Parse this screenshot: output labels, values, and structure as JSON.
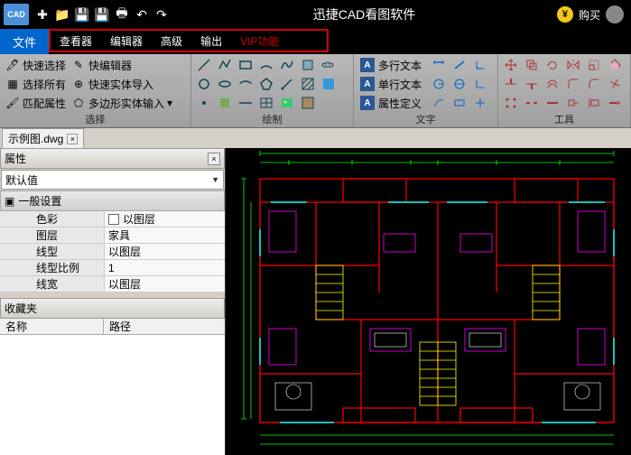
{
  "title": "迅捷CAD看图软件",
  "buy": "购买",
  "menu": {
    "file": "文件",
    "viewer": "查看器",
    "editor": "编辑器",
    "advanced": "高级",
    "output": "输出",
    "vip": "VIP功能"
  },
  "ribbon": {
    "select": {
      "label": "选择",
      "quick": "快速选择",
      "all": "选择所有",
      "match": "匹配属性",
      "qedit": "快编辑器",
      "impent": "快速实体导入",
      "polyin": "多边形实体输入"
    },
    "draw": {
      "label": "绘制"
    },
    "text": {
      "label": "文字",
      "mtext": "多行文本",
      "stext": "单行文本",
      "attdef": "属性定义"
    },
    "tools": {
      "label": "工具"
    }
  },
  "doc": {
    "name": "示例图.dwg"
  },
  "props": {
    "title": "属性",
    "default": "默认值",
    "general": "一般设置",
    "rows": {
      "color_k": "色彩",
      "color_v": "以图层",
      "layer_k": "图层",
      "layer_v": "家具",
      "ltype_k": "线型",
      "ltype_v": "以图层",
      "lscale_k": "线型比例",
      "lscale_v": "1",
      "lweight_k": "线宽",
      "lweight_v": "以图层"
    }
  },
  "fav": {
    "title": "收藏夹",
    "name": "名称",
    "path": "路径"
  }
}
